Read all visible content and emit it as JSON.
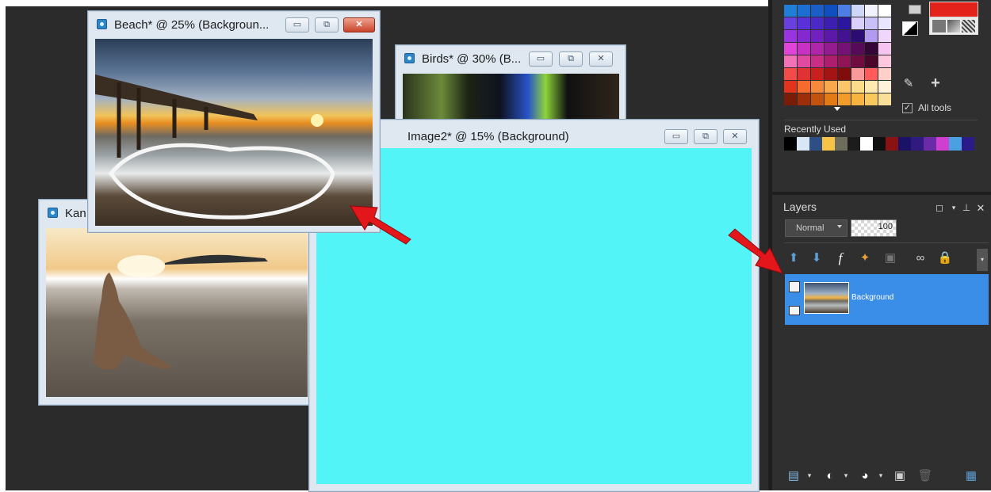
{
  "windows": {
    "beach": {
      "title": "Beach* @  25% (Backgroun..."
    },
    "birds": {
      "title": "Birds* @  30% (B..."
    },
    "kangaroo": {
      "title": "Kan"
    },
    "image2": {
      "title": "Image2* @  15% (Background)"
    }
  },
  "window_buttons": {
    "minimize": "▭",
    "restore": "⧉",
    "close": "✕"
  },
  "canvas_color": "#52f4f8",
  "colors": {
    "palette_title": "",
    "all_tools_label": "All tools",
    "recently_used_label": "Recently Used",
    "palette": [
      "#1f7fd8",
      "#1c6fd0",
      "#1a5fc8",
      "#0f4fc0",
      "#4d7ee6",
      "#cfd7f9",
      "#f2f2fc",
      "#ffffff",
      "#6a3fe0",
      "#5a30d8",
      "#4b28c8",
      "#3c1fb0",
      "#2b16a0",
      "#dad0fb",
      "#c8c0f7",
      "#e9e6fe",
      "#9a33e0",
      "#8428d0",
      "#7221c0",
      "#5c18a8",
      "#421290",
      "#2c0c70",
      "#b09bf1",
      "#f0d6fb",
      "#e044d8",
      "#c832c4",
      "#b025aa",
      "#941b90",
      "#761276",
      "#560b58",
      "#350538",
      "#f5c5ef",
      "#f272b8",
      "#e04aa0",
      "#ca2d86",
      "#ae1e6e",
      "#901456",
      "#6f0c40",
      "#4c062a",
      "#fbc8de",
      "#f34a4a",
      "#e03232",
      "#c81f1f",
      "#a51414",
      "#800c0c",
      "#f99a9a",
      "#ff5b5b",
      "#ffd0c8",
      "#e3331c",
      "#f46b2d",
      "#f78a3a",
      "#f9a84e",
      "#fbc56a",
      "#fddd8c",
      "#ffe9b0",
      "#fff2d8",
      "#7a1c08",
      "#9b2f0a",
      "#c2530e",
      "#e27b16",
      "#f19c2a",
      "#f7b441",
      "#f9c95d",
      "#f8e09a"
    ],
    "recent": [
      "#000000",
      "#d8e6f6",
      "#2e4f86",
      "#f6c347",
      "#6e6d5b",
      "#1c1c1c",
      "#ffffff",
      "#101010",
      "#8a1212",
      "#1a1266",
      "#301a80",
      "#6b2aa8",
      "#d040d0",
      "#4aa0e0",
      "#2a1a8a"
    ]
  },
  "layers": {
    "title": "Layers",
    "blend_mode": "Normal",
    "opacity": "100",
    "layer_name": "Background"
  }
}
